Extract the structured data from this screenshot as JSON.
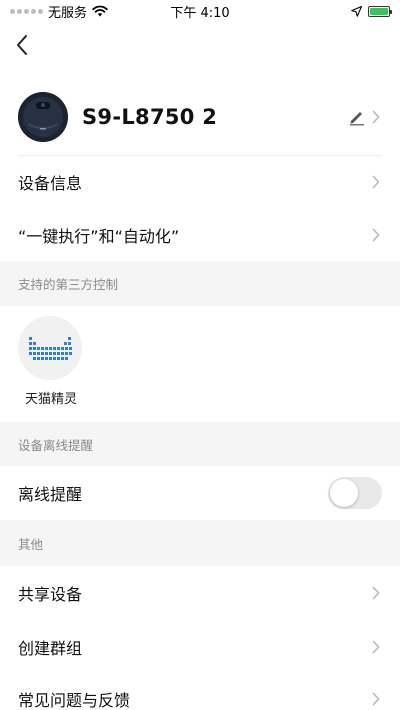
{
  "status_bar": {
    "carrier": "无服务",
    "time": "下午 4:10",
    "battery_color": "#34c759"
  },
  "device": {
    "name": "S9-L8750 2",
    "avatar_icon": "robot-vacuum-icon",
    "edit_icon": "pencil-icon"
  },
  "menu": {
    "device_info": "设备信息",
    "automation": "“一键执行”和“自动化”"
  },
  "third_party": {
    "header": "支持的第三方控制",
    "items": [
      {
        "label": "天猫精灵",
        "icon": "tmall-genie-icon"
      }
    ]
  },
  "offline": {
    "header": "设备离线提醒",
    "label": "离线提醒",
    "enabled": false
  },
  "others": {
    "header": "其他",
    "items": [
      {
        "label": "共享设备"
      },
      {
        "label": "创建群组"
      },
      {
        "label": "常见问题与反馈"
      }
    ]
  },
  "colors": {
    "section_bg": "#f5f5f5",
    "tmall_blue": "#2f7fd8"
  }
}
